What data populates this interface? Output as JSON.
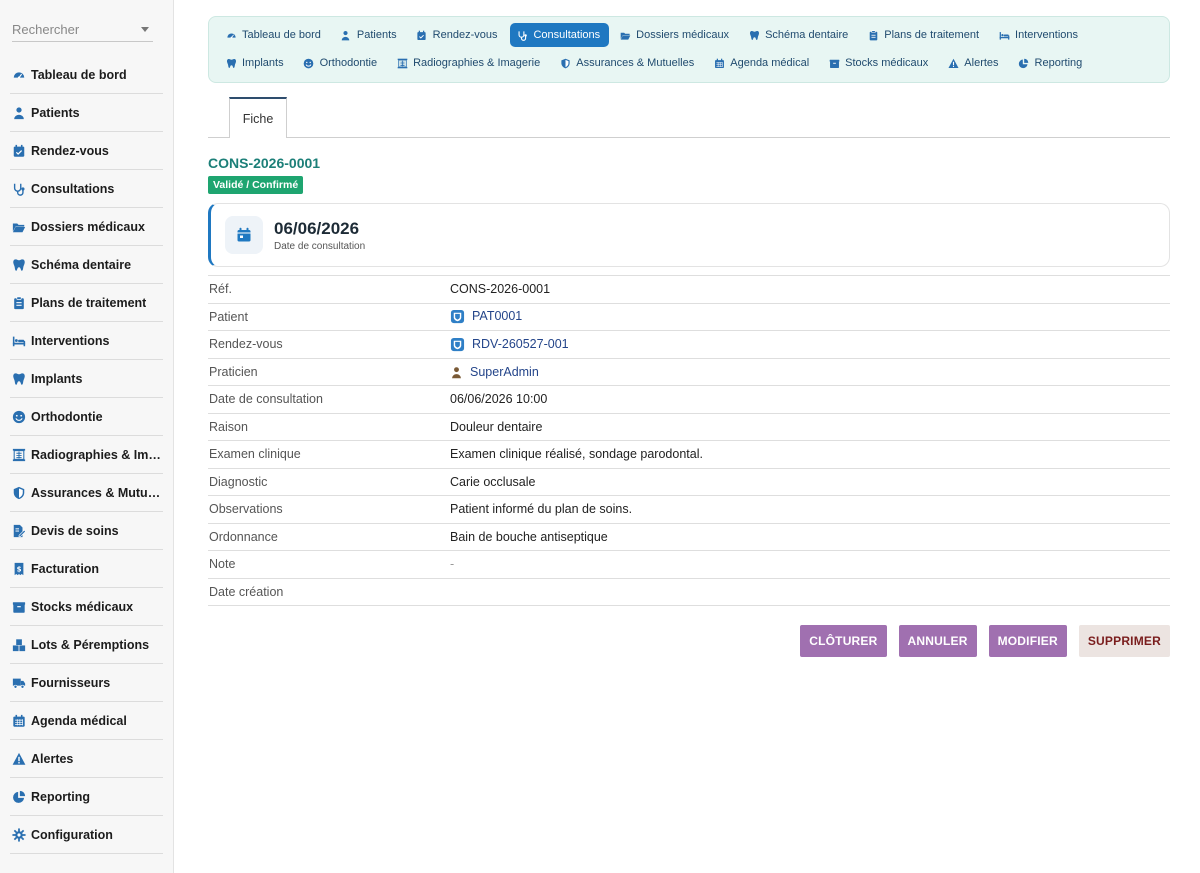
{
  "search": {
    "placeholder": "Rechercher"
  },
  "sidebar": {
    "items": [
      {
        "label": "Tableau de bord",
        "icon": "dashboard-icon"
      },
      {
        "label": "Patients",
        "icon": "user-icon"
      },
      {
        "label": "Rendez-vous",
        "icon": "calendar-check-icon"
      },
      {
        "label": "Consultations",
        "icon": "stethoscope-icon"
      },
      {
        "label": "Dossiers médicaux",
        "icon": "folder-open-icon"
      },
      {
        "label": "Schéma dentaire",
        "icon": "tooth-icon"
      },
      {
        "label": "Plans de traitement",
        "icon": "clipboard-icon"
      },
      {
        "label": "Interventions",
        "icon": "bed-icon"
      },
      {
        "label": "Implants",
        "icon": "tooth-icon"
      },
      {
        "label": "Orthodontie",
        "icon": "smile-icon"
      },
      {
        "label": "Radiographies & Imagerie",
        "icon": "xray-icon"
      },
      {
        "label": "Assurances & Mutuelles",
        "icon": "shield-icon"
      },
      {
        "label": "Devis de soins",
        "icon": "file-signature-icon"
      },
      {
        "label": "Facturation",
        "icon": "invoice-icon"
      },
      {
        "label": "Stocks médicaux",
        "icon": "box-icon"
      },
      {
        "label": "Lots & Péremptions",
        "icon": "boxes-icon"
      },
      {
        "label": "Fournisseurs",
        "icon": "truck-icon"
      },
      {
        "label": "Agenda médical",
        "icon": "calendar-icon"
      },
      {
        "label": "Alertes",
        "icon": "warning-icon"
      },
      {
        "label": "Reporting",
        "icon": "pie-chart-icon"
      },
      {
        "label": "Configuration",
        "icon": "gear-icon"
      }
    ]
  },
  "topnav": {
    "items": [
      {
        "label": "Tableau de bord",
        "icon": "dashboard-icon"
      },
      {
        "label": "Patients",
        "icon": "user-icon"
      },
      {
        "label": "Rendez-vous",
        "icon": "calendar-check-icon"
      },
      {
        "label": "Consultations",
        "icon": "stethoscope-icon",
        "active": true
      },
      {
        "label": "Dossiers médicaux",
        "icon": "folder-open-icon"
      },
      {
        "label": "Schéma dentaire",
        "icon": "tooth-icon"
      },
      {
        "label": "Plans de traitement",
        "icon": "clipboard-icon"
      },
      {
        "label": "Interventions",
        "icon": "bed-icon"
      },
      {
        "label": "Implants",
        "icon": "tooth-icon"
      },
      {
        "label": "Orthodontie",
        "icon": "smile-icon"
      },
      {
        "label": "Radiographies & Imagerie",
        "icon": "xray-icon"
      },
      {
        "label": "Assurances & Mutuelles",
        "icon": "shield-icon"
      },
      {
        "label": "Agenda médical",
        "icon": "calendar-icon"
      },
      {
        "label": "Stocks médicaux",
        "icon": "box-icon"
      },
      {
        "label": "Alertes",
        "icon": "warning-icon"
      },
      {
        "label": "Reporting",
        "icon": "pie-chart-icon"
      }
    ]
  },
  "tabs": {
    "fiche": "Fiche"
  },
  "record": {
    "ref": "CONS-2026-0001",
    "status": "Validé / Confirmé",
    "card_date": "06/06/2026",
    "card_label": "Date de consultation"
  },
  "fields": [
    {
      "key": "Réf.",
      "value": "CONS-2026-0001"
    },
    {
      "key": "Patient",
      "value": "PAT0001",
      "link": true,
      "icon": "patient-badge-icon"
    },
    {
      "key": "Rendez-vous",
      "value": "RDV-260527-001",
      "link": true,
      "icon": "appointment-badge-icon"
    },
    {
      "key": "Praticien",
      "value": "SuperAdmin",
      "link": true,
      "icon": "user-icon"
    },
    {
      "key": "Date de consultation",
      "value": "06/06/2026 10:00"
    },
    {
      "key": "Raison",
      "value": "Douleur dentaire"
    },
    {
      "key": "Examen clinique",
      "value": "Examen clinique réalisé, sondage parodontal."
    },
    {
      "key": "Diagnostic",
      "value": "Carie occlusale"
    },
    {
      "key": "Observations",
      "value": "Patient informé du plan de soins."
    },
    {
      "key": "Ordonnance",
      "value": "Bain de bouche antiseptique"
    },
    {
      "key": "Note",
      "value": "-",
      "muted": true
    },
    {
      "key": "Date création",
      "value": ""
    }
  ],
  "actions": {
    "close": "CLÔTURER",
    "cancel": "ANNULER",
    "edit": "MODIFIER",
    "delete": "SUPPRIMER"
  },
  "colors": {
    "accent": "#1f78c1",
    "status_badge": "#1ea570",
    "action_purple": "#a070b0",
    "ref_teal": "#1c7f78"
  }
}
